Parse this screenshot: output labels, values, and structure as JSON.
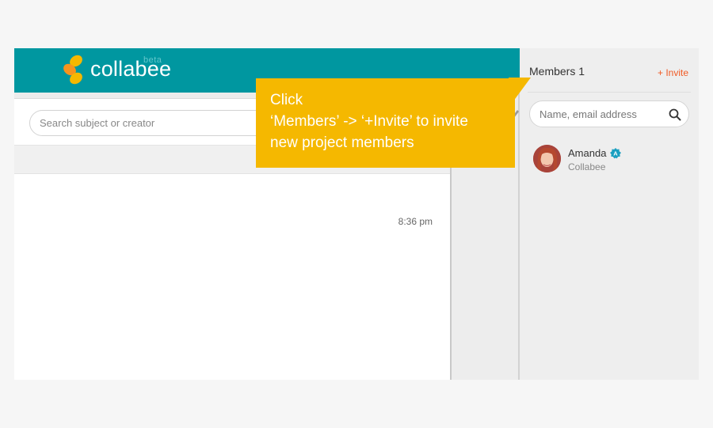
{
  "header": {
    "logo_text": "collabee",
    "logo_badge": "beta",
    "brand_color": "#0097a0",
    "logo_colors": [
      "#f5b800",
      "#f7941d"
    ]
  },
  "main": {
    "search": {
      "placeholder": "Search subject or creator",
      "value": ""
    },
    "rows": [
      {
        "time": "8:36 pm"
      }
    ]
  },
  "members_panel": {
    "title": "Members 1",
    "invite_label": "+ Invite",
    "invite_color": "#f05a24",
    "search": {
      "placeholder": "Name, email address",
      "value": ""
    },
    "members": [
      {
        "name": "Amanda",
        "org": "Collabee",
        "badge": "A",
        "badge_color": "#1a9fc0"
      }
    ]
  },
  "callout": {
    "lines": [
      "Click",
      "‘Members’ -> ‘+Invite’ to invite",
      "new project members"
    ],
    "color": "#f5b800"
  }
}
